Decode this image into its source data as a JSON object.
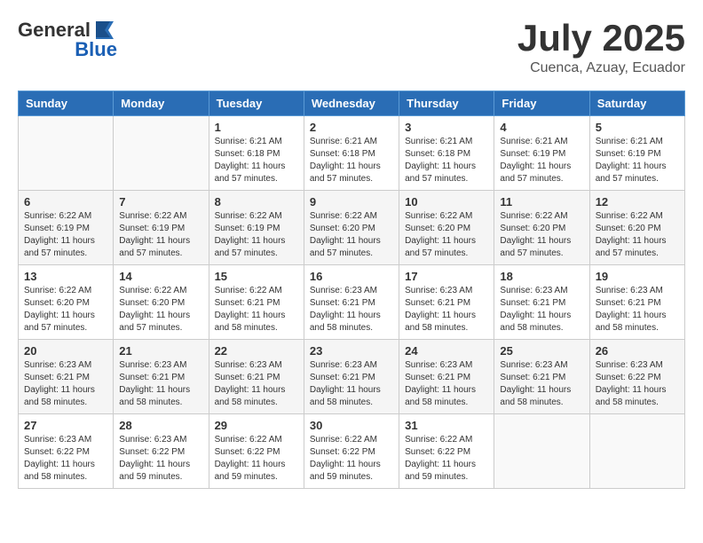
{
  "header": {
    "logo_general": "General",
    "logo_blue": "Blue",
    "month_title": "July 2025",
    "subtitle": "Cuenca, Azuay, Ecuador"
  },
  "weekdays": [
    "Sunday",
    "Monday",
    "Tuesday",
    "Wednesday",
    "Thursday",
    "Friday",
    "Saturday"
  ],
  "weeks": [
    [
      {
        "day": "",
        "info": ""
      },
      {
        "day": "",
        "info": ""
      },
      {
        "day": "1",
        "info": "Sunrise: 6:21 AM\nSunset: 6:18 PM\nDaylight: 11 hours and 57 minutes."
      },
      {
        "day": "2",
        "info": "Sunrise: 6:21 AM\nSunset: 6:18 PM\nDaylight: 11 hours and 57 minutes."
      },
      {
        "day": "3",
        "info": "Sunrise: 6:21 AM\nSunset: 6:18 PM\nDaylight: 11 hours and 57 minutes."
      },
      {
        "day": "4",
        "info": "Sunrise: 6:21 AM\nSunset: 6:19 PM\nDaylight: 11 hours and 57 minutes."
      },
      {
        "day": "5",
        "info": "Sunrise: 6:21 AM\nSunset: 6:19 PM\nDaylight: 11 hours and 57 minutes."
      }
    ],
    [
      {
        "day": "6",
        "info": "Sunrise: 6:22 AM\nSunset: 6:19 PM\nDaylight: 11 hours and 57 minutes."
      },
      {
        "day": "7",
        "info": "Sunrise: 6:22 AM\nSunset: 6:19 PM\nDaylight: 11 hours and 57 minutes."
      },
      {
        "day": "8",
        "info": "Sunrise: 6:22 AM\nSunset: 6:19 PM\nDaylight: 11 hours and 57 minutes."
      },
      {
        "day": "9",
        "info": "Sunrise: 6:22 AM\nSunset: 6:20 PM\nDaylight: 11 hours and 57 minutes."
      },
      {
        "day": "10",
        "info": "Sunrise: 6:22 AM\nSunset: 6:20 PM\nDaylight: 11 hours and 57 minutes."
      },
      {
        "day": "11",
        "info": "Sunrise: 6:22 AM\nSunset: 6:20 PM\nDaylight: 11 hours and 57 minutes."
      },
      {
        "day": "12",
        "info": "Sunrise: 6:22 AM\nSunset: 6:20 PM\nDaylight: 11 hours and 57 minutes."
      }
    ],
    [
      {
        "day": "13",
        "info": "Sunrise: 6:22 AM\nSunset: 6:20 PM\nDaylight: 11 hours and 57 minutes."
      },
      {
        "day": "14",
        "info": "Sunrise: 6:22 AM\nSunset: 6:20 PM\nDaylight: 11 hours and 57 minutes."
      },
      {
        "day": "15",
        "info": "Sunrise: 6:22 AM\nSunset: 6:21 PM\nDaylight: 11 hours and 58 minutes."
      },
      {
        "day": "16",
        "info": "Sunrise: 6:23 AM\nSunset: 6:21 PM\nDaylight: 11 hours and 58 minutes."
      },
      {
        "day": "17",
        "info": "Sunrise: 6:23 AM\nSunset: 6:21 PM\nDaylight: 11 hours and 58 minutes."
      },
      {
        "day": "18",
        "info": "Sunrise: 6:23 AM\nSunset: 6:21 PM\nDaylight: 11 hours and 58 minutes."
      },
      {
        "day": "19",
        "info": "Sunrise: 6:23 AM\nSunset: 6:21 PM\nDaylight: 11 hours and 58 minutes."
      }
    ],
    [
      {
        "day": "20",
        "info": "Sunrise: 6:23 AM\nSunset: 6:21 PM\nDaylight: 11 hours and 58 minutes."
      },
      {
        "day": "21",
        "info": "Sunrise: 6:23 AM\nSunset: 6:21 PM\nDaylight: 11 hours and 58 minutes."
      },
      {
        "day": "22",
        "info": "Sunrise: 6:23 AM\nSunset: 6:21 PM\nDaylight: 11 hours and 58 minutes."
      },
      {
        "day": "23",
        "info": "Sunrise: 6:23 AM\nSunset: 6:21 PM\nDaylight: 11 hours and 58 minutes."
      },
      {
        "day": "24",
        "info": "Sunrise: 6:23 AM\nSunset: 6:21 PM\nDaylight: 11 hours and 58 minutes."
      },
      {
        "day": "25",
        "info": "Sunrise: 6:23 AM\nSunset: 6:21 PM\nDaylight: 11 hours and 58 minutes."
      },
      {
        "day": "26",
        "info": "Sunrise: 6:23 AM\nSunset: 6:22 PM\nDaylight: 11 hours and 58 minutes."
      }
    ],
    [
      {
        "day": "27",
        "info": "Sunrise: 6:23 AM\nSunset: 6:22 PM\nDaylight: 11 hours and 58 minutes."
      },
      {
        "day": "28",
        "info": "Sunrise: 6:23 AM\nSunset: 6:22 PM\nDaylight: 11 hours and 59 minutes."
      },
      {
        "day": "29",
        "info": "Sunrise: 6:22 AM\nSunset: 6:22 PM\nDaylight: 11 hours and 59 minutes."
      },
      {
        "day": "30",
        "info": "Sunrise: 6:22 AM\nSunset: 6:22 PM\nDaylight: 11 hours and 59 minutes."
      },
      {
        "day": "31",
        "info": "Sunrise: 6:22 AM\nSunset: 6:22 PM\nDaylight: 11 hours and 59 minutes."
      },
      {
        "day": "",
        "info": ""
      },
      {
        "day": "",
        "info": ""
      }
    ]
  ]
}
